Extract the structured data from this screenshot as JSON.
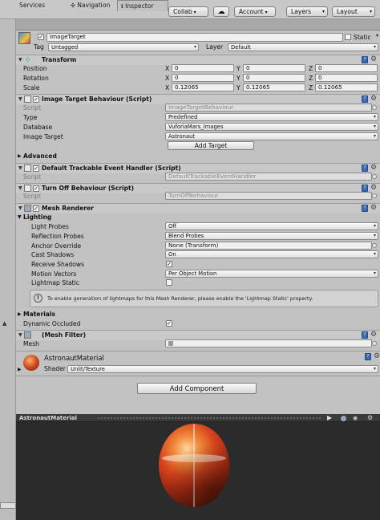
{
  "toolbar": {
    "collab": "Collab",
    "account": "Account",
    "layers": "Layers",
    "layout": "Layout"
  },
  "tabs": [
    {
      "label": "Services"
    },
    {
      "label": "Navigation"
    },
    {
      "label": "Inspector"
    }
  ],
  "object": {
    "name": "ImageTarget",
    "static_label": "Static",
    "tag_label": "Tag",
    "tag_value": "Untagged",
    "layer_label": "Layer",
    "layer_value": "Default"
  },
  "transform": {
    "title": "Transform",
    "position": {
      "label": "Position",
      "x": "0",
      "y": "0",
      "z": "0"
    },
    "rotation": {
      "label": "Rotation",
      "x": "0",
      "y": "0",
      "z": "0"
    },
    "scale": {
      "label": "Scale",
      "x": "0.12065",
      "y": "0.12065",
      "z": "0.12065"
    },
    "axes": {
      "x": "X",
      "y": "Y",
      "z": "Z"
    }
  },
  "itb": {
    "title": "Image Target Behaviour (Script)",
    "script_label": "Script",
    "script_value": "ImageTargetBehaviour",
    "type_label": "Type",
    "type_value": "Predefined",
    "database_label": "Database",
    "database_value": "VuforiaMars_Images",
    "image_label": "Image Target",
    "image_value": "Astronaut",
    "add_target": "Add Target",
    "advanced": "Advanced"
  },
  "dteh": {
    "title": "Default Trackable Event Handler (Script)",
    "script_label": "Script",
    "script_value": "DefaultTrackableEventHandler"
  },
  "tob": {
    "title": "Turn Off Behaviour (Script)",
    "script_label": "Script",
    "script_value": "TurnOffBehaviour"
  },
  "mesh_renderer": {
    "title": "Mesh Renderer",
    "lighting": "Lighting",
    "light_probes_label": "Light Probes",
    "light_probes_value": "Off",
    "reflection_probes_label": "Reflection Probes",
    "reflection_probes_value": "Blend Probes",
    "anchor_label": "Anchor Override",
    "anchor_value": "None (Transform)",
    "cast_label": "Cast Shadows",
    "cast_value": "On",
    "receive_label": "Receive Shadows",
    "motion_label": "Motion Vectors",
    "motion_value": "Per Object Motion",
    "lightmap_label": "Lightmap Static",
    "info": "To enable generation of lightmaps for this Mesh Renderer, please enable the 'Lightmap Static' property.",
    "materials": "Materials",
    "dynamic_label": "Dynamic Occluded"
  },
  "mesh_filter": {
    "title": "(Mesh Filter)",
    "mesh_label": "Mesh"
  },
  "material": {
    "name": "AstronautMaterial",
    "shader_label": "Shader",
    "shader_value": "Unlit/Texture"
  },
  "add_component": "Add Component",
  "preview": {
    "title": "AstronautMaterial"
  }
}
